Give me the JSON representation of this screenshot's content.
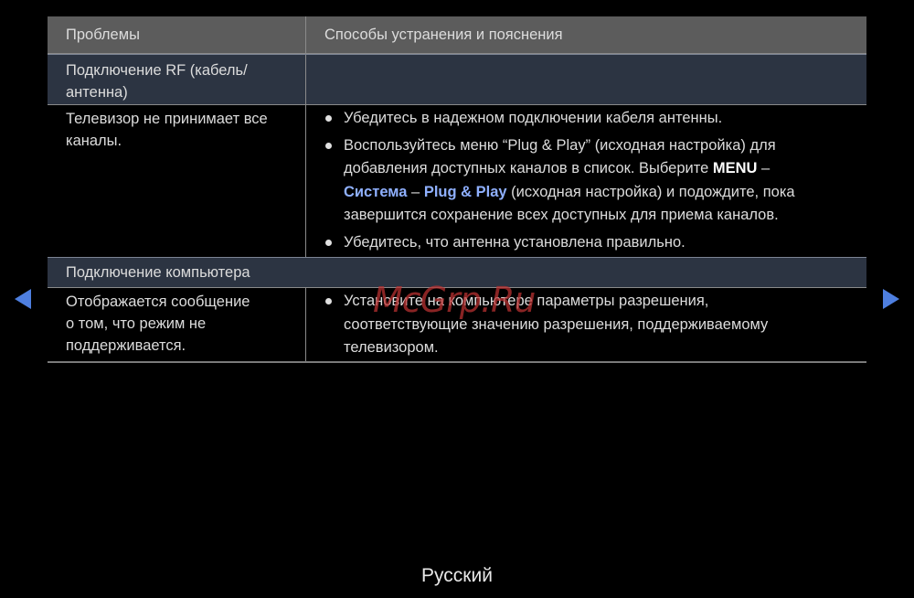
{
  "table": {
    "header": {
      "col1": "Проблемы",
      "col2": "Способы устранения и пояснения"
    },
    "section1": {
      "title": "Подключение RF (кабель/антенна)",
      "title_line1": "Подключение RF (кабель/",
      "title_line2": "антенна)"
    },
    "row1": {
      "problem": "Телевизор не принимает все каналы.",
      "problem_line1": "Телевизор не принимает все",
      "problem_line2": "каналы.",
      "bullet1": "Убедитесь в надежном подключении кабеля антенны.",
      "bullet2": {
        "line1": "Воспользуйтесь меню “Plug & Play” (исходная настройка) для",
        "line2_pre": "добавления доступных каналов в список. Выберите ",
        "menu": "MENU",
        "sep1": " –",
        "system": "Система",
        "sep2": " – ",
        "plugplay": "Plug & Play",
        "line3_post": " (исходная настройка) и подождите, пока",
        "line4": "завершится сохранение всех доступных для приема каналов."
      },
      "bullet3": "Убедитесь, что антенна установлена правильно."
    },
    "section2": {
      "title": "Подключение компьютера"
    },
    "row2": {
      "problem_line1": "Отображается сообщение",
      "problem_line2": "о том, что режим не",
      "problem_line3": "поддерживается.",
      "bullet1_line1": "Установите на компьютере параметры разрешения,",
      "bullet1_line2": "соответствующие значению разрешения, поддерживаемому",
      "bullet1_line3": "телевизором."
    }
  },
  "nav": {
    "prev_icon": "triangle-left-icon",
    "next_icon": "triangle-right-icon",
    "accent": "#4e7fe0"
  },
  "footer": {
    "language": "Русский"
  },
  "watermark": "McGrp.Ru"
}
